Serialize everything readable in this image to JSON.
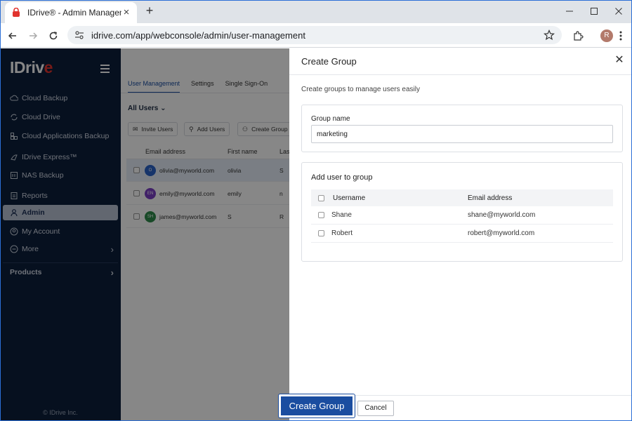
{
  "browser": {
    "tab_title": "IDrive® - Admin Management",
    "url": "idrive.com/app/webconsole/admin/user-management",
    "profile_initial": "R"
  },
  "sidebar": {
    "logo_main": "IDriv",
    "logo_accent": "e",
    "items": [
      {
        "label": "Cloud Backup",
        "icon": "cloud-upload-icon"
      },
      {
        "label": "Cloud Drive",
        "icon": "sync-icon"
      },
      {
        "label": "Cloud Applications Backup",
        "icon": "apps-icon"
      },
      {
        "label": "IDrive Express™",
        "icon": "express-icon"
      },
      {
        "label": "NAS Backup",
        "icon": "nas-icon"
      },
      {
        "label": "Reports",
        "icon": "report-icon"
      },
      {
        "label": "Admin",
        "icon": "admin-icon"
      },
      {
        "label": "My Account",
        "icon": "account-icon"
      },
      {
        "label": "More",
        "icon": "more-icon"
      }
    ],
    "products_label": "Products",
    "copyright": "© IDrive Inc."
  },
  "main": {
    "tabs": [
      "User Management",
      "Settings",
      "Single Sign-On"
    ],
    "filter_label": "All Users",
    "actions": [
      "Invite Users",
      "Add Users",
      "Create Group"
    ],
    "columns": [
      "Email address",
      "First name",
      "Last"
    ],
    "users": [
      {
        "initials": "O",
        "email": "olivia@myworld.com",
        "first": "olivia",
        "last": "S",
        "color": "#2a63c9"
      },
      {
        "initials": "EN",
        "email": "emily@myworld.com",
        "first": "emily",
        "last": "n",
        "color": "#7b3fc4"
      },
      {
        "initials": "SH",
        "email": "james@myworld.com",
        "first": "S",
        "last": "R",
        "color": "#2f8a4a"
      }
    ]
  },
  "drawer": {
    "title": "Create Group",
    "subtitle": "Create groups to manage users easily",
    "group_name_label": "Group name",
    "group_name_value": "marketing",
    "add_user_label": "Add user to group",
    "columns": [
      "Username",
      "Email address"
    ],
    "rows": [
      {
        "username": "Shane",
        "email": "shane@myworld.com"
      },
      {
        "username": "Robert",
        "email": "robert@myworld.com"
      }
    ],
    "create_button": "Create Group",
    "cancel_button": "Cancel"
  },
  "colors": {
    "sidebar_bg": "#0d1f3c",
    "accent": "#1a4da0",
    "brand_red": "#e1332e"
  }
}
